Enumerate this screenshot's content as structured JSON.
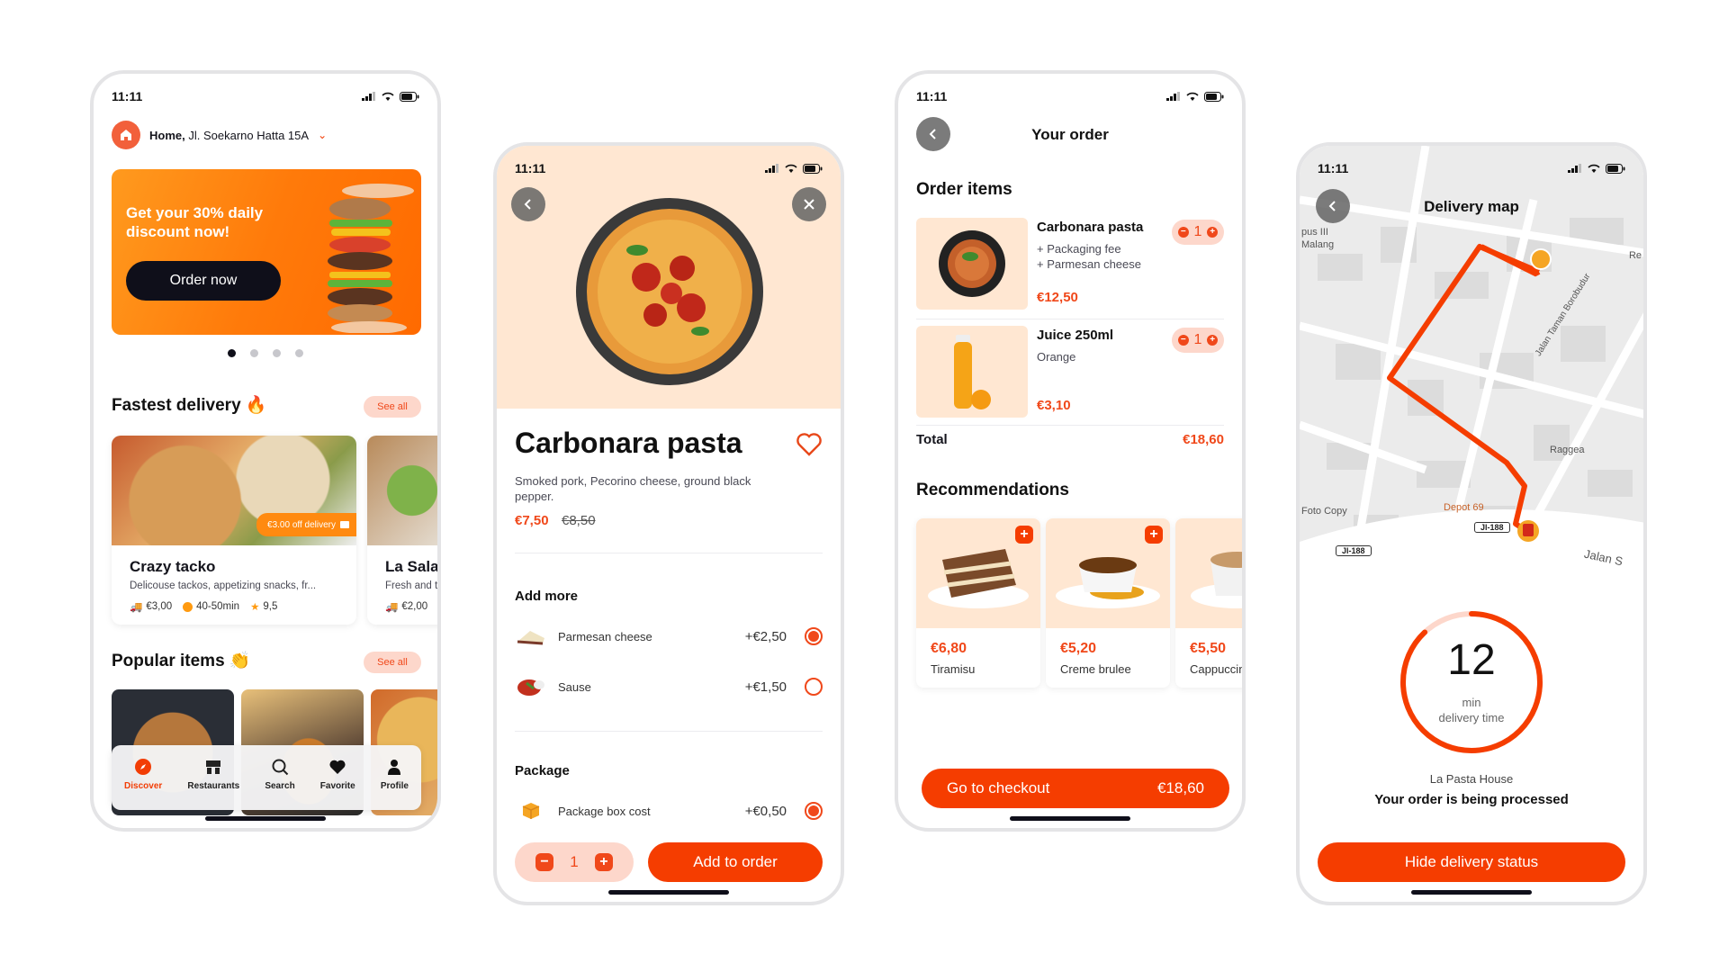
{
  "colors": {
    "accent": "#F53D00",
    "accent_soft": "#FDD7CB",
    "peach_bg": "#FFE7D2",
    "dark": "#0F0F1A"
  },
  "status_bar": {
    "time": "11:11"
  },
  "discover": {
    "address_label": "Home,",
    "address_value": "Jl. Soekarno Hatta 15A",
    "promo": {
      "text": "Get your 30% daily discount now!",
      "button": "Order now"
    },
    "carousel": {
      "count": 4,
      "active_index": 0
    },
    "fastest_delivery": {
      "title": "Fastest delivery 🔥",
      "see_all": "See all",
      "restaurants": [
        {
          "name": "Crazy tacko",
          "description": "Delicouse tackos, appetizing snacks, fr...",
          "delivery_fee": "€3,00",
          "time": "40-50min",
          "rating": "9,5",
          "badge": "€3.00 off delivery"
        },
        {
          "name": "La Sala",
          "description": "Fresh and t",
          "delivery_fee": "€2,00"
        }
      ]
    },
    "popular_items": {
      "title": "Popular items 👏",
      "see_all": "See all"
    },
    "tabs": [
      {
        "label": "Discover",
        "icon": "compass-icon",
        "active": true
      },
      {
        "label": "Restaurants",
        "icon": "storefront-icon",
        "active": false
      },
      {
        "label": "Search",
        "icon": "search-icon",
        "active": false
      },
      {
        "label": "Favorite",
        "icon": "heart-icon",
        "active": false
      },
      {
        "label": "Profile",
        "icon": "person-icon",
        "active": false
      }
    ]
  },
  "dish": {
    "title": "Carbonara pasta",
    "description": "Smoked pork, Pecorino cheese, ground black pepper.",
    "price": "€7,50",
    "old_price": "€8,50",
    "add_more_title": "Add more",
    "add_more": [
      {
        "name": "Parmesan cheese",
        "price": "+€2,50",
        "selected": true
      },
      {
        "name": "Sause",
        "price": "+€1,50",
        "selected": false
      }
    ],
    "package_title": "Package",
    "package": [
      {
        "name": "Package box cost",
        "price": "+€0,50",
        "selected": true
      }
    ],
    "quantity": "1",
    "add_button": "Add to order"
  },
  "order": {
    "title": "Your order",
    "items_title": "Order items",
    "items": [
      {
        "name": "Carbonara pasta",
        "extras": [
          "+ Packaging fee",
          "+ Parmesan cheese"
        ],
        "price": "€12,50",
        "qty": "1"
      },
      {
        "name": "Juice 250ml",
        "extras": [
          "Orange"
        ],
        "price": "€3,10",
        "qty": "1"
      }
    ],
    "total_label": "Total",
    "total_value": "€18,60",
    "recommendations_title": "Recommendations",
    "recommendations": [
      {
        "name": "Tiramisu",
        "price": "€6,80"
      },
      {
        "name": "Creme brulee",
        "price": "€5,20"
      },
      {
        "name": "Cappuccino",
        "price": "€5,50"
      }
    ],
    "checkout_label": "Go to checkout",
    "checkout_value": "€18,60"
  },
  "delivery": {
    "title": "Delivery map",
    "map_labels": {
      "place1": "pus III",
      "place2": "Malang",
      "street": "Jalan Taman Borobudur",
      "hotel": "Raggea",
      "restaurant": "Depot 69",
      "shop": "Foto Copy",
      "road_tag": "Jl-188",
      "edge_right": "Re",
      "edge_bottom": "Jalan S"
    },
    "minutes": "12",
    "unit": "min",
    "unit_sub": "delivery time",
    "progress_fraction": 0.88,
    "restaurant": "La Pasta House",
    "status": "Your order is being processed",
    "hide_button": "Hide delivery status"
  }
}
